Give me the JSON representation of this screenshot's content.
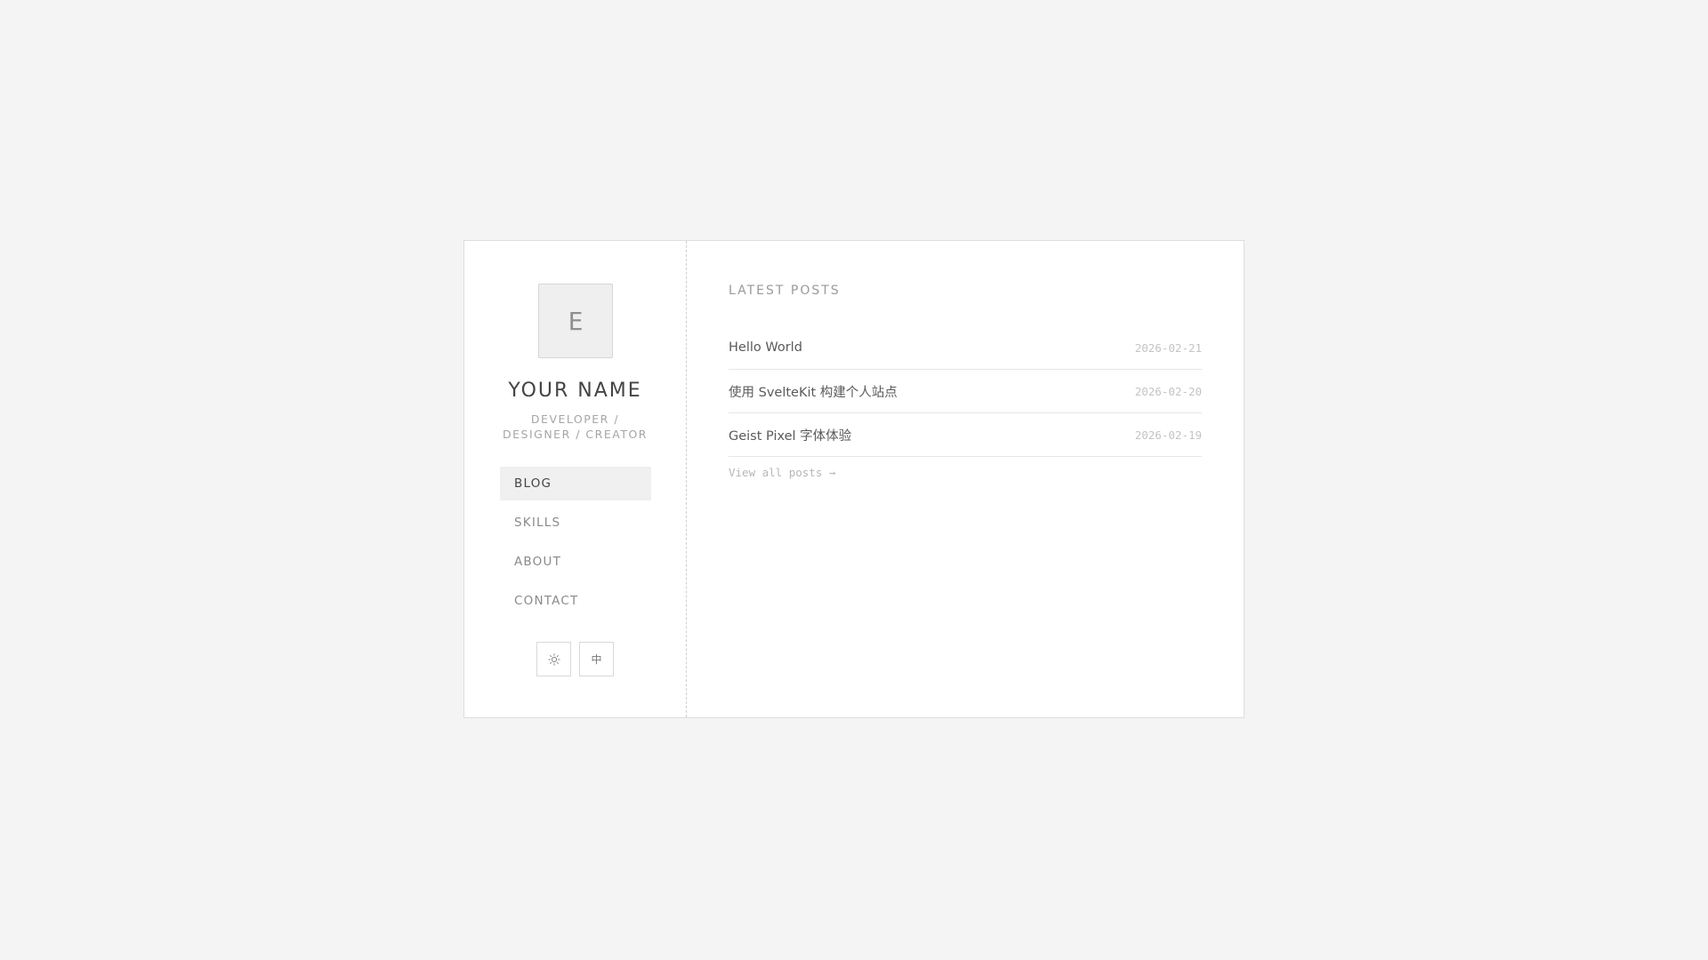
{
  "profile": {
    "avatar_letter": "E",
    "name": "YOUR NAME",
    "subtitle_line1": "DEVELOPER /",
    "subtitle_line2": "DESIGNER / CREATOR"
  },
  "nav": {
    "items": [
      {
        "label": "BLOG",
        "active": true
      },
      {
        "label": "SKILLS",
        "active": false
      },
      {
        "label": "ABOUT",
        "active": false
      },
      {
        "label": "CONTACT",
        "active": false
      }
    ]
  },
  "controls": {
    "theme_icon": "sun-icon",
    "language_label": "中"
  },
  "main": {
    "section_title": "LATEST POSTS",
    "posts": [
      {
        "title": "Hello World",
        "date": "2026-02-21"
      },
      {
        "title": "使用 SvelteKit 构建个人站点",
        "date": "2026-02-20"
      },
      {
        "title": "Geist Pixel 字体体验",
        "date": "2026-02-19"
      }
    ],
    "view_all": "View all posts →"
  },
  "colors": {
    "background": "#f4f4f4",
    "card": "#ffffff",
    "active_nav": "#f0f0f0"
  }
}
